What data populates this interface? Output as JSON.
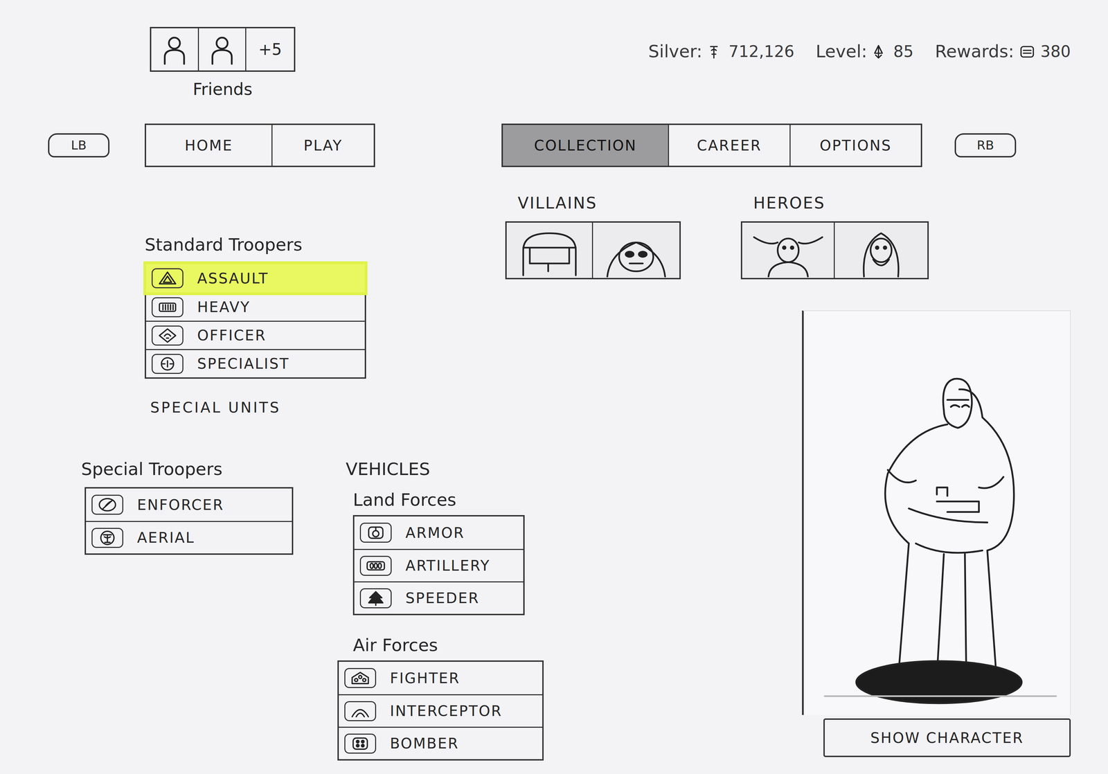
{
  "friends": {
    "label": "Friends",
    "more": "+5"
  },
  "stats": [
    {
      "label": "Silver:",
      "value": "712,126"
    },
    {
      "label": "Level:",
      "value": "85"
    },
    {
      "label": "Rewards:",
      "value": "380"
    }
  ],
  "bumpers": {
    "left": "LB",
    "right": "RB"
  },
  "main_tabs": [
    {
      "label": "HOME",
      "selected": false
    },
    {
      "label": "PLAY",
      "selected": false
    }
  ],
  "section_tabs": [
    {
      "label": "COLLECTION",
      "selected": true
    },
    {
      "label": "CAREER",
      "selected": false
    },
    {
      "label": "OPTIONS",
      "selected": false
    }
  ],
  "villains": {
    "label": "VILLAINS"
  },
  "heroes": {
    "label": "HEROES"
  },
  "standard_troopers": {
    "title": "Standard Troopers",
    "items": [
      {
        "label": "ASSAULT",
        "selected": true
      },
      {
        "label": "HEAVY",
        "selected": false
      },
      {
        "label": "OFFICER",
        "selected": false
      },
      {
        "label": "SPECIALIST",
        "selected": false
      }
    ]
  },
  "special_units": {
    "title": "SPECIAL UNITS",
    "special_troopers": {
      "title": "Special Troopers",
      "items": [
        {
          "label": "ENFORCER",
          "selected": false
        },
        {
          "label": "AERIAL",
          "selected": false
        }
      ]
    },
    "vehicles": {
      "title": "VEHICLES",
      "land": {
        "title": "Land Forces",
        "items": [
          {
            "label": "ARMOR",
            "selected": false
          },
          {
            "label": "ARTILLERY",
            "selected": false
          },
          {
            "label": "SPEEDER",
            "selected": false
          }
        ]
      },
      "air": {
        "title": "Air Forces",
        "items": [
          {
            "label": "FIGHTER",
            "selected": false
          },
          {
            "label": "INTERCEPTOR",
            "selected": false
          },
          {
            "label": "BOMBER",
            "selected": false
          }
        ]
      }
    }
  },
  "preview": {
    "button": "SHOW CHARACTER"
  }
}
